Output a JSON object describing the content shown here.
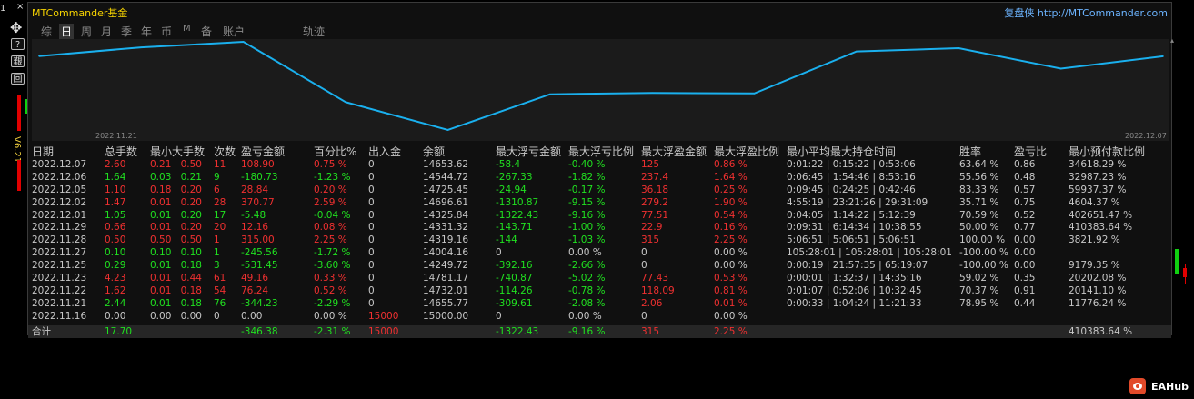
{
  "left_toolbar": {
    "num_label": "1",
    "close_label": "×",
    "help_label": "?",
    "grid_label": "艱",
    "window_label": "回",
    "version_label": "V6.21"
  },
  "header": {
    "brand": "MTCommander基金",
    "site": "复盘侠 http://MTCommander.com"
  },
  "tabs": [
    {
      "label": "综",
      "active": false
    },
    {
      "label": "日",
      "active": true
    },
    {
      "label": "周",
      "active": false
    },
    {
      "label": "月",
      "active": false
    },
    {
      "label": "季",
      "active": false
    },
    {
      "label": "年",
      "active": false
    },
    {
      "label": "币",
      "active": false
    },
    {
      "label": "M",
      "active": false
    },
    {
      "label": "备",
      "active": false
    },
    {
      "label": "账户",
      "active": false
    },
    {
      "label": "轨迹",
      "active": false
    }
  ],
  "chart_data": {
    "type": "line",
    "x": [
      "2022.11.21",
      "2022.11.22",
      "2022.11.23",
      "2022.11.25",
      "2022.11.27",
      "2022.11.28",
      "2022.11.29",
      "2022.12.01",
      "2022.12.02",
      "2022.12.05",
      "2022.12.06",
      "2022.12.07"
    ],
    "y": [
      14655.77,
      14732.01,
      14781.17,
      14249.72,
      14004.16,
      14319.16,
      14331.32,
      14325.84,
      14696.61,
      14725.45,
      14544.72,
      14653.62
    ],
    "ylim": [
      14004.16,
      14781.17
    ],
    "start_label": "2022.11.21",
    "end_label": "2022.12.07",
    "color": "#1ab0ee"
  },
  "table": {
    "headers": [
      "日期",
      "总手数",
      "最小大手数",
      "次数",
      "盈亏金额",
      "百分比%",
      "出入金",
      "余额",
      "最大浮亏金额",
      "最大浮亏比例",
      "最大浮盈金额",
      "最大浮盈比例",
      "最小平均最大持仓时间",
      "胜率",
      "盈亏比",
      "最小预付款比例"
    ],
    "rows": [
      {
        "date": "2022.12.07",
        "lots": "2.60",
        "minmax": "0.21 | 0.50",
        "count": "11",
        "pnl": "108.90",
        "pct": "0.75 %",
        "flow": "0",
        "balance": "14653.62",
        "max_float_loss": "-58.4",
        "max_float_loss_pct": "-0.40 %",
        "max_float_profit": "125",
        "max_float_profit_pct": "0.86 %",
        "hold": "0:01:22 | 0:15:22 | 0:53:06",
        "win": "63.64 %",
        "pl": "0.86",
        "margin": "34618.29 %",
        "tone": "red"
      },
      {
        "date": "2022.12.06",
        "lots": "1.64",
        "minmax": "0.03 | 0.21",
        "count": "9",
        "pnl": "-180.73",
        "pct": "-1.23 %",
        "flow": "0",
        "balance": "14544.72",
        "max_float_loss": "-267.33",
        "max_float_loss_pct": "-1.82 %",
        "max_float_profit": "237.4",
        "max_float_profit_pct": "1.64 %",
        "hold": "0:06:45 | 1:54:46 | 8:53:16",
        "win": "55.56 %",
        "pl": "0.48",
        "margin": "32987.23 %",
        "tone": "green"
      },
      {
        "date": "2022.12.05",
        "lots": "1.10",
        "minmax": "0.18 | 0.20",
        "count": "6",
        "pnl": "28.84",
        "pct": "0.20 %",
        "flow": "0",
        "balance": "14725.45",
        "max_float_loss": "-24.94",
        "max_float_loss_pct": "-0.17 %",
        "max_float_profit": "36.18",
        "max_float_profit_pct": "0.25 %",
        "hold": "0:09:45 | 0:24:25 | 0:42:46",
        "win": "83.33 %",
        "pl": "0.57",
        "margin": "59937.37 %",
        "tone": "red"
      },
      {
        "date": "2022.12.02",
        "lots": "1.47",
        "minmax": "0.01 | 0.20",
        "count": "28",
        "pnl": "370.77",
        "pct": "2.59 %",
        "flow": "0",
        "balance": "14696.61",
        "max_float_loss": "-1310.87",
        "max_float_loss_pct": "-9.15 %",
        "max_float_profit": "279.2",
        "max_float_profit_pct": "1.90 %",
        "hold": "4:55:19 | 23:21:26 | 29:31:09",
        "win": "35.71 %",
        "pl": "0.75",
        "margin": "4604.37 %",
        "tone": "red"
      },
      {
        "date": "2022.12.01",
        "lots": "1.05",
        "minmax": "0.01 | 0.20",
        "count": "17",
        "pnl": "-5.48",
        "pct": "-0.04 %",
        "flow": "0",
        "balance": "14325.84",
        "max_float_loss": "-1322.43",
        "max_float_loss_pct": "-9.16 %",
        "max_float_profit": "77.51",
        "max_float_profit_pct": "0.54 %",
        "hold": "0:04:05 | 1:14:22 | 5:12:39",
        "win": "70.59 %",
        "pl": "0.52",
        "margin": "402651.47 %",
        "tone": "green"
      },
      {
        "date": "2022.11.29",
        "lots": "0.66",
        "minmax": "0.01 | 0.20",
        "count": "20",
        "pnl": "12.16",
        "pct": "0.08 %",
        "flow": "0",
        "balance": "14331.32",
        "max_float_loss": "-143.71",
        "max_float_loss_pct": "-1.00 %",
        "max_float_profit": "22.9",
        "max_float_profit_pct": "0.16 %",
        "hold": "0:09:31 | 6:14:34 | 10:38:55",
        "win": "50.00 %",
        "pl": "0.77",
        "margin": "410383.64 %",
        "tone": "red"
      },
      {
        "date": "2022.11.28",
        "lots": "0.50",
        "minmax": "0.50 | 0.50",
        "count": "1",
        "pnl": "315.00",
        "pct": "2.25 %",
        "flow": "0",
        "balance": "14319.16",
        "max_float_loss": "-144",
        "max_float_loss_pct": "-1.03 %",
        "max_float_profit": "315",
        "max_float_profit_pct": "2.25 %",
        "hold": "5:06:51 | 5:06:51 | 5:06:51",
        "win": "100.00 %",
        "pl": "0.00",
        "margin": "3821.92 %",
        "tone": "red"
      },
      {
        "date": "2022.11.27",
        "lots": "0.10",
        "minmax": "0.10 | 0.10",
        "count": "1",
        "pnl": "-245.56",
        "pct": "-1.72 %",
        "flow": "0",
        "balance": "14004.16",
        "max_float_loss": "0",
        "max_float_loss_pct": "0.00 %",
        "max_float_profit": "0",
        "max_float_profit_pct": "0.00 %",
        "hold": "105:28:01 | 105:28:01 | 105:28:01",
        "win": "-100.00 %",
        "pl": "0.00",
        "margin": "",
        "tone": "green"
      },
      {
        "date": "2022.11.25",
        "lots": "0.29",
        "minmax": "0.01 | 0.18",
        "count": "3",
        "pnl": "-531.45",
        "pct": "-3.60 %",
        "flow": "0",
        "balance": "14249.72",
        "max_float_loss": "-392.16",
        "max_float_loss_pct": "-2.66 %",
        "max_float_profit": "0",
        "max_float_profit_pct": "0.00 %",
        "hold": "0:00:19 | 21:57:35 | 65:19:07",
        "win": "-100.00 %",
        "pl": "0.00",
        "margin": "9179.35 %",
        "tone": "green"
      },
      {
        "date": "2022.11.23",
        "lots": "4.23",
        "minmax": "0.01 | 0.44",
        "count": "61",
        "pnl": "49.16",
        "pct": "0.33 %",
        "flow": "0",
        "balance": "14781.17",
        "max_float_loss": "-740.87",
        "max_float_loss_pct": "-5.02 %",
        "max_float_profit": "77.43",
        "max_float_profit_pct": "0.53 %",
        "hold": "0:00:01 | 1:32:37 | 14:35:16",
        "win": "59.02 %",
        "pl": "0.35",
        "margin": "20202.08 %",
        "tone": "red"
      },
      {
        "date": "2022.11.22",
        "lots": "1.62",
        "minmax": "0.01 | 0.18",
        "count": "54",
        "pnl": "76.24",
        "pct": "0.52 %",
        "flow": "0",
        "balance": "14732.01",
        "max_float_loss": "-114.26",
        "max_float_loss_pct": "-0.78 %",
        "max_float_profit": "118.09",
        "max_float_profit_pct": "0.81 %",
        "hold": "0:01:07 | 0:52:06 | 10:32:45",
        "win": "70.37 %",
        "pl": "0.91",
        "margin": "20141.10 %",
        "tone": "red"
      },
      {
        "date": "2022.11.21",
        "lots": "2.44",
        "minmax": "0.01 | 0.18",
        "count": "76",
        "pnl": "-344.23",
        "pct": "-2.29 %",
        "flow": "0",
        "balance": "14655.77",
        "max_float_loss": "-309.61",
        "max_float_loss_pct": "-2.08 %",
        "max_float_profit": "2.06",
        "max_float_profit_pct": "0.01 %",
        "hold": "0:00:33 | 1:04:24 | 11:21:33",
        "win": "78.95 %",
        "pl": "0.44",
        "margin": "11776.24 %",
        "tone": "green"
      },
      {
        "date": "2022.11.16",
        "lots": "0.00",
        "minmax": "0.00 | 0.00",
        "count": "0",
        "pnl": "0.00",
        "pct": "0.00 %",
        "flow": "15000",
        "balance": "15000.00",
        "max_float_loss": "0",
        "max_float_loss_pct": "0.00 %",
        "max_float_profit": "0",
        "max_float_profit_pct": "0.00 %",
        "hold": "",
        "win": "",
        "pl": "",
        "margin": "",
        "tone": "neutral"
      }
    ],
    "total": {
      "label": "合计",
      "lots": "17.70",
      "pnl": "-346.38",
      "pct": "-2.31 %",
      "flow": "15000",
      "max_float_loss": "-1322.43",
      "max_float_loss_pct": "-9.16 %",
      "max_float_profit": "315",
      "max_float_profit_pct": "2.25 %",
      "margin": "410383.64 %"
    }
  },
  "watermark": {
    "text": "EAHub"
  },
  "colors": {
    "profit": "#f03030",
    "loss": "#20e020",
    "accent": "#f5d200",
    "link": "#6cb4ff",
    "line": "#1ab0ee"
  }
}
